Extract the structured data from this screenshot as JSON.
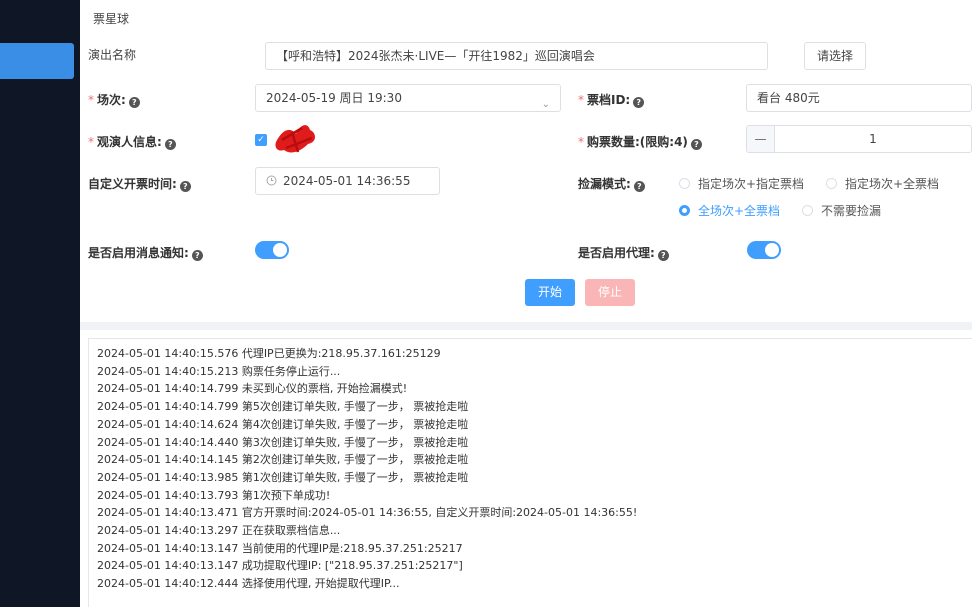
{
  "app": {
    "title": "票星球"
  },
  "form": {
    "show_name": {
      "label": "演出名称",
      "value": "【呼和浩特】2024张杰未·LIVE—「开往1982」巡回演唱会",
      "select_button": "请选择"
    },
    "session": {
      "label": "场次:",
      "value": "2024-05-19 周日 19:30"
    },
    "ticket_tier": {
      "label": "票档ID:",
      "value": "看台 480元"
    },
    "viewer": {
      "label": "观演人信息:"
    },
    "quantity": {
      "label": "购票数量:(限购:4)",
      "value": "1",
      "minus": "—"
    },
    "custom_time": {
      "label": "自定义开票时间:",
      "value": "2024-05-01 14:36:55"
    },
    "grab_mode": {
      "label": "捡漏模式:",
      "options": [
        "指定场次+指定票档",
        "指定场次+全票档",
        "全场次+全票档",
        "不需要捡漏"
      ],
      "selected": "全场次+全票档"
    },
    "notify": {
      "label": "是否启用消息通知:",
      "enabled": true
    },
    "proxy": {
      "label": "是否启用代理:",
      "enabled": true
    },
    "start_button": "开始",
    "stop_button": "停止"
  },
  "icons": {
    "help": "?",
    "clock": "clock-icon",
    "check": "✓",
    "chevron": "⌄"
  },
  "logs": [
    "2024-05-01 14:40:15.576 代理IP已更换为:218.95.37.161:25129",
    "2024-05-01 14:40:15.213 购票任务停止运行...",
    "2024-05-01 14:40:14.799 未买到心仪的票档, 开始捡漏模式!",
    "2024-05-01 14:40:14.799 第5次创建订单失败, 手慢了一步， 票被抢走啦",
    "2024-05-01 14:40:14.624 第4次创建订单失败, 手慢了一步， 票被抢走啦",
    "2024-05-01 14:40:14.440 第3次创建订单失败, 手慢了一步， 票被抢走啦",
    "2024-05-01 14:40:14.145 第2次创建订单失败, 手慢了一步， 票被抢走啦",
    "2024-05-01 14:40:13.985 第1次创建订单失败, 手慢了一步， 票被抢走啦",
    "2024-05-01 14:40:13.793 第1次预下单成功!",
    "2024-05-01 14:40:13.471 官方开票时间:2024-05-01 14:36:55, 自定义开票时间:2024-05-01 14:36:55!",
    "2024-05-01 14:40:13.297 正在获取票档信息...",
    "2024-05-01 14:40:13.147 当前使用的代理IP是:218.95.37.251:25217",
    "2024-05-01 14:40:13.147 成功提取代理IP: [\"218.95.37.251:25217\"]",
    "2024-05-01 14:40:12.444 选择使用代理, 开始提取代理IP..."
  ]
}
